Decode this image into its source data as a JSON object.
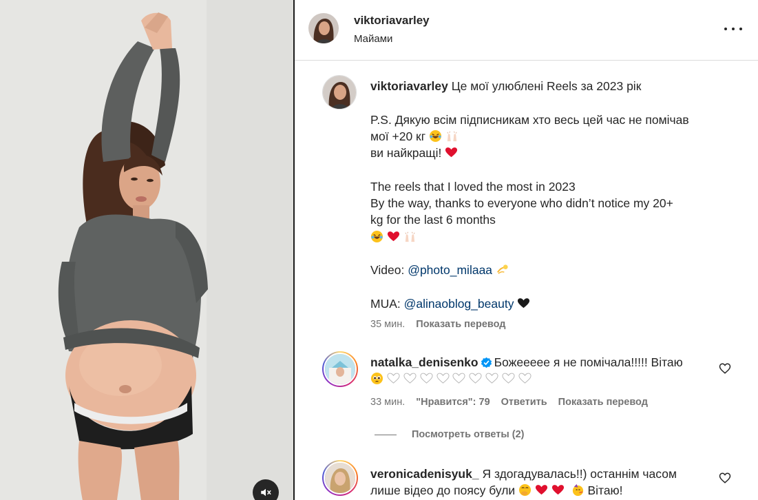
{
  "header": {
    "username": "viktoriavarley",
    "location": "Майами"
  },
  "caption": {
    "username": "viktoriavarley",
    "line1": "Це мої улюблені Reels за 2023 рік",
    "line2": "P.S. Дякую всім підписникам хто весь цей час не помічав",
    "line3": "мої +20 кг",
    "line4": "ви найкращі!",
    "line5": "The reels that I loved the most in 2023",
    "line6": "By the way, thanks to everyone who didn’t notice my 20+",
    "line7": "kg for the last 6 months",
    "video_label": "Video:",
    "video_link": "@photo_milaaa",
    "mua_label": "MUA:",
    "mua_link": "@alinaoblog_beauty",
    "time": "35 мин.",
    "translate": "Показать перевод"
  },
  "comments": [
    {
      "username": "natalka_denisenko",
      "text": "Божеееее я не помічала!!!!! Вітаю",
      "time": "33 мин.",
      "likes": "\"Нравится\": 79",
      "reply": "Ответить",
      "translate": "Показать перевод",
      "view_replies": "Посмотреть ответы (2)"
    },
    {
      "username": "veronicadenisyuk_",
      "text1": "Я здогадувалась!!) останнім часом",
      "text2": "лише відео до поясу були",
      "text3": "Вітаю!"
    }
  ],
  "icons": {
    "more": "more-horizontal-icon",
    "mute": "muted-speaker-icon",
    "like": "heart-outline-icon",
    "verified": "verified-badge-icon"
  },
  "colors": {
    "link": "#00376b",
    "secondary_text": "#737373",
    "verified": "#0095f6",
    "heart_red": "#e0102e"
  }
}
